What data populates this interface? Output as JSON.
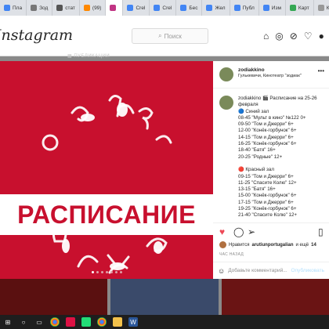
{
  "browser": {
    "tabs": [
      {
        "label": "Пла",
        "icon": "grid-icon",
        "color": "#4285f4"
      },
      {
        "label": "Зод",
        "icon": "page-icon",
        "color": "#777777"
      },
      {
        "label": "стат",
        "icon": "chart-icon",
        "color": "#555555"
      },
      {
        "label": "(99)",
        "icon": "mail-icon",
        "color": "#ff8800"
      },
      {
        "label": "",
        "icon": "instagram-icon",
        "color": "#c13584"
      },
      {
        "label": "Crel",
        "icon": "google-icon",
        "color": "#4285f4"
      },
      {
        "label": "Crel",
        "icon": "google-icon",
        "color": "#4285f4"
      },
      {
        "label": "Бес",
        "icon": "google-icon",
        "color": "#4285f4"
      },
      {
        "label": "Жел",
        "icon": "google-icon",
        "color": "#4285f4"
      },
      {
        "label": "Публ",
        "icon": "google-icon",
        "color": "#4285f4"
      },
      {
        "label": "Изм",
        "icon": "google-icon",
        "color": "#4285f4"
      },
      {
        "label": "Карт",
        "icon": "map-icon",
        "color": "#34a853"
      },
      {
        "label": "Конт",
        "icon": "contact-icon",
        "color": "#999999"
      },
      {
        "label": "Син",
        "icon": "sheets-icon",
        "color": "#0f9d58"
      }
    ]
  },
  "header": {
    "logo": "Instagram",
    "search_placeholder": "Поиск",
    "nav_icons": [
      "home-icon",
      "messenger-icon",
      "explore-icon",
      "activity-icon",
      "profile-icon"
    ]
  },
  "background_strip": "▦ ПУБЛИКАЦИИ",
  "post": {
    "image_text": "РАСПИСАНИЕ",
    "carousel_dots": 7,
    "carousel_active": 1,
    "username": "zodiakkino",
    "location": "Гулькевичи, Кинотеатр \"зодиак\"",
    "caption_lines": [
      "zodiakkino 🎬 Расписание на 25-26",
      "февраля",
      "🔵 Синий зал",
      "08-45 \"Мульт в кино\" №122 0+",
      "09-50 \"Том и Джерри\" 6+",
      "12-00 \"Конёк-горбунок\" 6+",
      "14-15 \"Том и Джерри\" 6+",
      "16-25 \"Конёк-горбунок\" 6+",
      "18-40 \"Батя\" 16+",
      "20-25 \"Родные\" 12+",
      "",
      "🔴 Красный зал",
      "09-15 \"Том и Джерри\" 6+",
      "11-25 \"Спасите Колю\" 12+",
      "13-15 \"Батя\" 16+",
      "15-00 \"Конёк-горбунок\" 6+",
      "17-15 \"Том и Джерри\" 6+",
      "19-25 \"Конёк-горбунок\" 6+",
      "21-40 \"Спасите Колю\" 12+"
    ],
    "likes_prefix": "Нравится",
    "likes_user": "arutiunportugalian",
    "likes_suffix": "и ещё",
    "likes_count": "14",
    "time": "ЧАС НАЗАД",
    "comment_placeholder": "Добавьте комментарий...",
    "publish_label": "Опубликовать",
    "like_color": "#ed4956",
    "accent_color": "#c8102e"
  },
  "taskbar": {
    "items": [
      "windows-icon",
      "search-icon",
      "task-view-icon",
      "chrome-icon",
      "media-icon",
      "paint-icon",
      "chrome-icon",
      "explorer-icon",
      "word-icon"
    ]
  }
}
